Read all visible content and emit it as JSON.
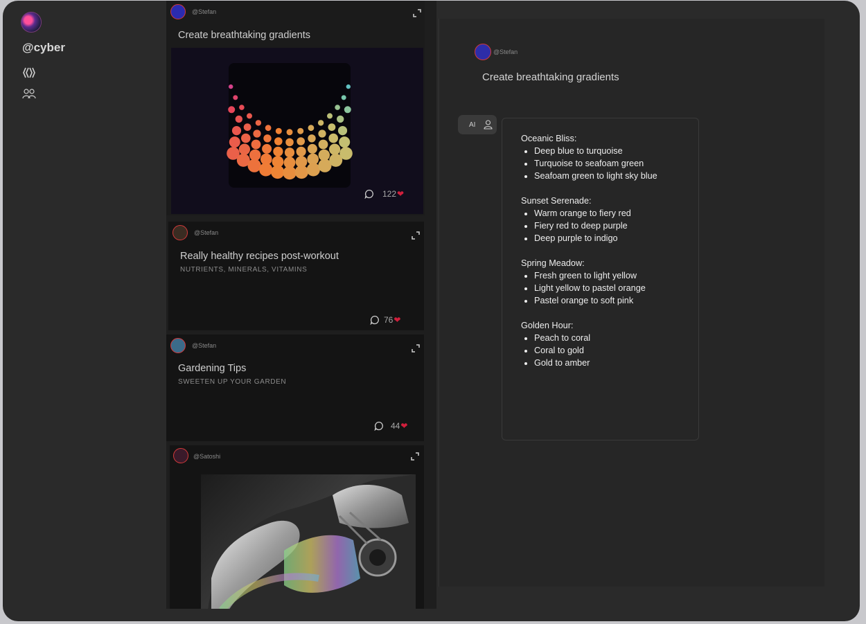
{
  "sidebar": {
    "username": "@cyber",
    "nav": [
      {
        "icon": "feed-icon"
      },
      {
        "icon": "people-icon"
      }
    ]
  },
  "feed": {
    "cards": [
      {
        "user": "@Stefan",
        "title": "Create breathtaking gradients",
        "comments_icon": "comment-icon",
        "likes": "122"
      },
      {
        "user": "@Stefan",
        "title": "Really healthy recipes post-workout",
        "subtitle": "NUTRIENTS, MINERALS, VITAMINS",
        "likes": "76"
      },
      {
        "user": "@Stefan",
        "title": "Gardening Tips",
        "subtitle": "SWEETEN UP YOUR GARDEN",
        "likes": "44"
      },
      {
        "user": "@Satoshi"
      }
    ]
  },
  "detail": {
    "user": "@Stefan",
    "title": "Create breathtaking gradients",
    "ai_toggle_label": "AI",
    "groups": [
      {
        "heading": "Oceanic Bliss:",
        "items": [
          "Deep blue to turquoise",
          "Turquoise to seafoam green",
          "Seafoam green to light sky blue"
        ]
      },
      {
        "heading": "Sunset Serenade:",
        "items": [
          "Warm orange to fiery red",
          "Fiery red to deep purple",
          "Deep purple to indigo"
        ]
      },
      {
        "heading": "Spring Meadow:",
        "items": [
          "Fresh green to light yellow",
          "Light yellow to pastel orange",
          "Pastel orange to soft pink"
        ]
      },
      {
        "heading": "Golden Hour:",
        "items": [
          "Peach to coral",
          "Coral to gold",
          "Gold to amber"
        ]
      }
    ]
  },
  "colors": {
    "window_bg": "#2a2a2a",
    "card_bg": "#141414",
    "heart": "#d11f3c",
    "avatar_ring": "#d33a3a"
  }
}
